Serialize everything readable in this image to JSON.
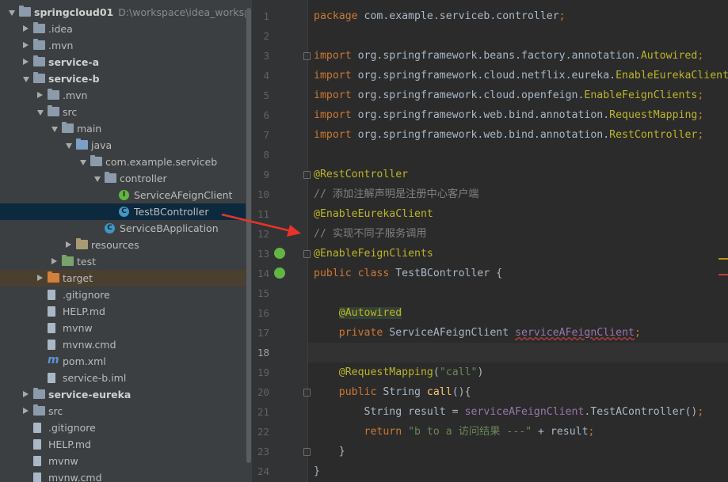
{
  "project_tree": {
    "items": [
      {
        "label": "springcloud01",
        "path": "D:\\workspace\\idea_workspace",
        "depth": 0,
        "icon": "module-folder-icon",
        "arrow": "down",
        "bold": true
      },
      {
        "label": ".idea",
        "depth": 1,
        "icon": "folder-icon",
        "arrow": "right"
      },
      {
        "label": ".mvn",
        "depth": 1,
        "icon": "folder-icon",
        "arrow": "right"
      },
      {
        "label": "service-a",
        "depth": 1,
        "icon": "module-folder-icon",
        "arrow": "right",
        "bold": true
      },
      {
        "label": "service-b",
        "depth": 1,
        "icon": "module-folder-icon",
        "arrow": "down",
        "bold": true
      },
      {
        "label": ".mvn",
        "depth": 2,
        "icon": "folder-icon",
        "arrow": "right"
      },
      {
        "label": "src",
        "depth": 2,
        "icon": "folder-icon",
        "arrow": "down"
      },
      {
        "label": "main",
        "depth": 3,
        "icon": "folder-icon",
        "arrow": "down"
      },
      {
        "label": "java",
        "depth": 4,
        "icon": "source-folder-icon",
        "arrow": "down"
      },
      {
        "label": "com.example.serviceb",
        "depth": 5,
        "icon": "package-icon",
        "arrow": "down"
      },
      {
        "label": "controller",
        "depth": 6,
        "icon": "package-icon",
        "arrow": "down"
      },
      {
        "label": "ServiceAFeignClient",
        "depth": 7,
        "icon": "interface-icon",
        "arrow": "none"
      },
      {
        "label": "TestBController",
        "depth": 7,
        "icon": "class-icon",
        "arrow": "none",
        "selected": true
      },
      {
        "label": "ServiceBApplication",
        "depth": 6,
        "icon": "spring-boot-class-icon",
        "arrow": "none"
      },
      {
        "label": "resources",
        "depth": 4,
        "icon": "resources-folder-icon",
        "arrow": "right"
      },
      {
        "label": "test",
        "depth": 3,
        "icon": "test-folder-icon",
        "arrow": "right"
      },
      {
        "label": "target",
        "depth": 2,
        "icon": "excluded-folder-icon",
        "arrow": "right",
        "excluded": true
      },
      {
        "label": ".gitignore",
        "depth": 2,
        "icon": "text-file-icon",
        "arrow": "none"
      },
      {
        "label": "HELP.md",
        "depth": 2,
        "icon": "markdown-file-icon",
        "arrow": "none"
      },
      {
        "label": "mvnw",
        "depth": 2,
        "icon": "text-file-icon",
        "arrow": "none"
      },
      {
        "label": "mvnw.cmd",
        "depth": 2,
        "icon": "text-file-icon",
        "arrow": "none"
      },
      {
        "label": "pom.xml",
        "depth": 2,
        "icon": "maven-pom-icon",
        "arrow": "none"
      },
      {
        "label": "service-b.iml",
        "depth": 2,
        "icon": "iml-file-icon",
        "arrow": "none"
      },
      {
        "label": "service-eureka",
        "depth": 1,
        "icon": "module-folder-icon",
        "arrow": "right",
        "bold": true
      },
      {
        "label": "src",
        "depth": 1,
        "icon": "folder-icon",
        "arrow": "right"
      },
      {
        "label": ".gitignore",
        "depth": 1,
        "icon": "text-file-icon",
        "arrow": "none"
      },
      {
        "label": "HELP.md",
        "depth": 1,
        "icon": "markdown-file-icon",
        "arrow": "none"
      },
      {
        "label": "mvnw",
        "depth": 1,
        "icon": "text-file-icon",
        "arrow": "none"
      },
      {
        "label": "mvnw.cmd",
        "depth": 1,
        "icon": "text-file-icon",
        "arrow": "none"
      }
    ]
  },
  "editor": {
    "current_line": 18,
    "lines": [
      {
        "n": "1",
        "tokens": [
          [
            "kw",
            "package "
          ],
          [
            "",
            "com.example.serviceb.controller"
          ],
          [
            "kw",
            ";"
          ]
        ]
      },
      {
        "n": "2",
        "tokens": []
      },
      {
        "n": "3",
        "tokens": [
          [
            "kw",
            "import "
          ],
          [
            "",
            "org.springframework.beans.factory.annotation."
          ],
          [
            "ann",
            "Autowired"
          ],
          [
            "kw",
            ";"
          ]
        ]
      },
      {
        "n": "4",
        "tokens": [
          [
            "kw",
            "import "
          ],
          [
            "",
            "org.springframework.cloud.netflix.eureka."
          ],
          [
            "ann",
            "EnableEurekaClient"
          ],
          [
            "kw",
            ";"
          ]
        ]
      },
      {
        "n": "5",
        "tokens": [
          [
            "kw",
            "import "
          ],
          [
            "",
            "org.springframework.cloud.openfeign."
          ],
          [
            "ann",
            "EnableFeignClients"
          ],
          [
            "kw",
            ";"
          ]
        ]
      },
      {
        "n": "6",
        "tokens": [
          [
            "kw",
            "import "
          ],
          [
            "",
            "org.springframework.web.bind.annotation."
          ],
          [
            "ann",
            "RequestMapping"
          ],
          [
            "kw",
            ";"
          ]
        ]
      },
      {
        "n": "7",
        "tokens": [
          [
            "kw",
            "import "
          ],
          [
            "",
            "org.springframework.web.bind.annotation."
          ],
          [
            "ann",
            "RestController"
          ],
          [
            "kw",
            ";"
          ]
        ]
      },
      {
        "n": "8",
        "tokens": []
      },
      {
        "n": "9",
        "tokens": [
          [
            "ann",
            "@RestController"
          ]
        ]
      },
      {
        "n": "10",
        "tokens": [
          [
            "cmt",
            "// 添加注解声明是注册中心客户端"
          ]
        ]
      },
      {
        "n": "11",
        "tokens": [
          [
            "ann",
            "@EnableEurekaClient"
          ]
        ]
      },
      {
        "n": "12",
        "tokens": [
          [
            "cmt",
            "// 实现不同子服务调用"
          ]
        ]
      },
      {
        "n": "13",
        "tokens": [
          [
            "ann",
            "@EnableFeignClients"
          ]
        ]
      },
      {
        "n": "14",
        "tokens": [
          [
            "kw",
            "public class "
          ],
          [
            "",
            "TestBController {"
          ]
        ]
      },
      {
        "n": "15",
        "tokens": []
      },
      {
        "n": "16",
        "tokens": [
          [
            "",
            "    "
          ],
          [
            "ann hl",
            "@Autowired"
          ]
        ]
      },
      {
        "n": "17",
        "tokens": [
          [
            "",
            "    "
          ],
          [
            "kw",
            "private "
          ],
          [
            "",
            "ServiceAFeignClient "
          ],
          [
            "fld err",
            "serviceAFeignClient"
          ],
          [
            "kw",
            ";"
          ]
        ]
      },
      {
        "n": "18",
        "tokens": []
      },
      {
        "n": "19",
        "tokens": [
          [
            "",
            "    "
          ],
          [
            "ann",
            "@RequestMapping"
          ],
          [
            "",
            "("
          ],
          [
            "str",
            "\"call\""
          ],
          [
            "",
            ")"
          ]
        ]
      },
      {
        "n": "20",
        "tokens": [
          [
            "",
            "    "
          ],
          [
            "kw",
            "public "
          ],
          [
            "",
            "String "
          ],
          [
            "fn",
            "call"
          ],
          [
            "",
            "(){"
          ]
        ]
      },
      {
        "n": "21",
        "tokens": [
          [
            "",
            "        String result = "
          ],
          [
            "fld",
            "serviceAFeignClient"
          ],
          [
            "",
            ".TestAController()"
          ],
          [
            "kw",
            ";"
          ]
        ]
      },
      {
        "n": "22",
        "tokens": [
          [
            "",
            "        "
          ],
          [
            "kw",
            "return "
          ],
          [
            "str",
            "\"b to a 访问结果 ---\""
          ],
          [
            "",
            " + result"
          ],
          [
            "kw",
            ";"
          ]
        ]
      },
      {
        "n": "23",
        "tokens": [
          [
            "",
            "    }"
          ]
        ]
      },
      {
        "n": "24",
        "tokens": [
          [
            "",
            "}"
          ]
        ]
      }
    ]
  },
  "colors": {
    "keyword": "#cc7832",
    "annotation": "#bbb529",
    "comment": "#808080",
    "string": "#6a8759",
    "field": "#9876aa",
    "arrow_annotation": "#e8332a"
  }
}
